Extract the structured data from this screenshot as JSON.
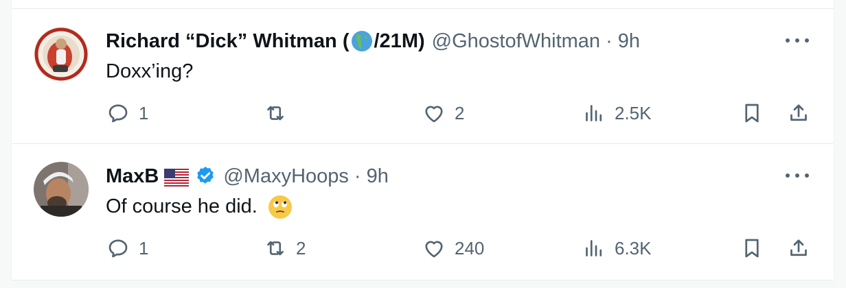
{
  "tweets": [
    {
      "name_part1": "Richard “Dick” Whitman (",
      "name_part2": "/21M)",
      "name_icon": "globe-americas-emoji",
      "handle": "@GhostofWhitman",
      "separator": "·",
      "time": "9h",
      "text": "Doxx’ing?",
      "actions": {
        "replies": "1",
        "retweets": "",
        "likes": "2",
        "views": "2.5K"
      }
    },
    {
      "name": "MaxB",
      "name_icons": [
        "us-flag-emoji",
        "verified-badge-icon"
      ],
      "handle": "@MaxyHoops",
      "separator": "·",
      "time": "9h",
      "text": "Of course he did.",
      "text_emoji": "face-with-rolling-eyes-emoji",
      "actions": {
        "replies": "1",
        "retweets": "2",
        "likes": "240",
        "views": "6.3K"
      }
    }
  ],
  "icons": [
    "reply-icon",
    "retweet-icon",
    "like-icon",
    "views-icon",
    "bookmark-icon",
    "share-icon",
    "more-icon"
  ],
  "colors": {
    "text": "#0f1419",
    "secondary": "#536471",
    "verified": "#1d9bf0",
    "border": "#e6ecf0"
  }
}
